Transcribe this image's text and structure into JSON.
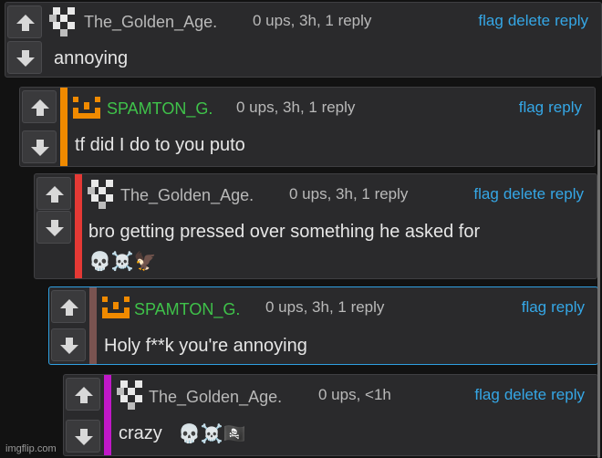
{
  "comments": [
    {
      "username": "The_Golden_Age.",
      "meta": "0 ups, 3h, 1 reply",
      "actions": [
        "flag",
        "delete",
        "reply"
      ],
      "body": "annoying",
      "emoji": ""
    },
    {
      "username": "SPAMTON_G.",
      "meta": "0 ups, 3h, 1 reply",
      "actions": [
        "flag",
        "reply"
      ],
      "body": "tf did I do to you puto",
      "emoji": ""
    },
    {
      "username": "The_Golden_Age.",
      "meta": "0 ups, 3h, 1 reply",
      "actions": [
        "flag",
        "delete",
        "reply"
      ],
      "body": "bro getting pressed over something he asked for",
      "emoji": "💀☠️🦅"
    },
    {
      "username": "SPAMTON_G.",
      "meta": "0 ups, 3h, 1 reply",
      "actions": [
        "flag",
        "reply"
      ],
      "body": "Holy f**k you're annoying",
      "emoji": ""
    },
    {
      "username": "The_Golden_Age.",
      "meta": "0 ups, <1h",
      "actions": [
        "flag",
        "delete",
        "reply"
      ],
      "body": "crazy",
      "emoji": "💀☠️🏴‍☠️"
    }
  ],
  "colors": {
    "golden_user": "#b9b9b9",
    "spamton_user": "#3fc24a",
    "link": "#35a7e6",
    "accent_orange": "#f08a00",
    "accent_red": "#e53935",
    "accent_brown": "#7a5350",
    "accent_magenta": "#c118c8"
  },
  "icons": {
    "upvote": "arrow-up-icon",
    "downvote": "arrow-down-icon"
  },
  "watermark": "imgflip.com"
}
